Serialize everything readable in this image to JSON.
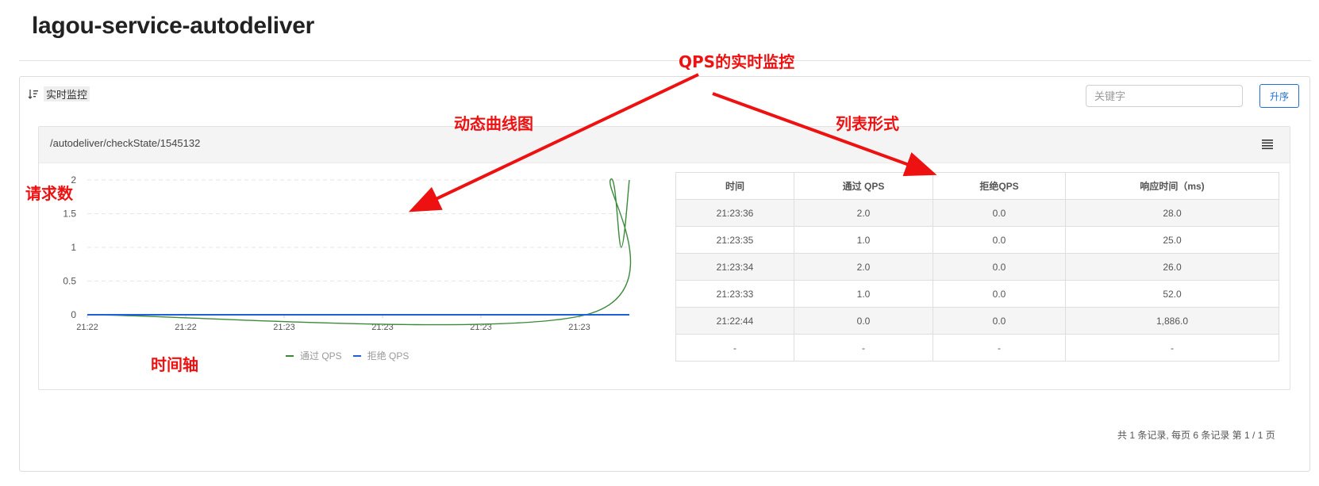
{
  "app": {
    "title": "lagou-service-autodeliver"
  },
  "panel": {
    "header_label": "实时监控",
    "search_placeholder": "关键字",
    "sort_button": "升序"
  },
  "card": {
    "resource_path": "/autodeliver/checkState/1545132"
  },
  "chart_data": {
    "type": "line",
    "y_ticks": [
      "0",
      "0.5",
      "1",
      "1.5",
      "2"
    ],
    "x_ticks": [
      "21:22",
      "21:22",
      "21:23",
      "21:23",
      "21:23",
      "21:23"
    ],
    "ylim": [
      0,
      2
    ],
    "grid": true,
    "legend_position": "bottom",
    "series": [
      {
        "name": "通过 QPS",
        "color": "#3a8a3a",
        "x": [
          0,
          0.92,
          0.965,
          0.985,
          1.0
        ],
        "values": [
          0,
          0,
          2,
          1,
          2
        ]
      },
      {
        "name": "拒绝 QPS",
        "color": "#1f5fdc",
        "x": [
          0,
          1.0
        ],
        "values": [
          0,
          0
        ]
      }
    ]
  },
  "table": {
    "headers": [
      "时间",
      "通过 QPS",
      "拒绝QPS",
      "响应时间（ms)"
    ],
    "rows": [
      [
        "21:23:36",
        "2.0",
        "0.0",
        "28.0"
      ],
      [
        "21:23:35",
        "1.0",
        "0.0",
        "25.0"
      ],
      [
        "21:23:34",
        "2.0",
        "0.0",
        "26.0"
      ],
      [
        "21:23:33",
        "1.0",
        "0.0",
        "52.0"
      ],
      [
        "21:22:44",
        "0.0",
        "0.0",
        "1,886.0"
      ],
      [
        "-",
        "-",
        "-",
        "-"
      ]
    ]
  },
  "pagination": {
    "text": "共 1 条记录, 每页 6 条记录 第 1 / 1 页"
  },
  "annotations": {
    "qps_realtime": "QPS的实时监控",
    "dynamic_curve": "动态曲线图",
    "list_form": "列表形式",
    "request_count": "请求数",
    "time_axis": "时间轴",
    "color": "#ee1111"
  }
}
